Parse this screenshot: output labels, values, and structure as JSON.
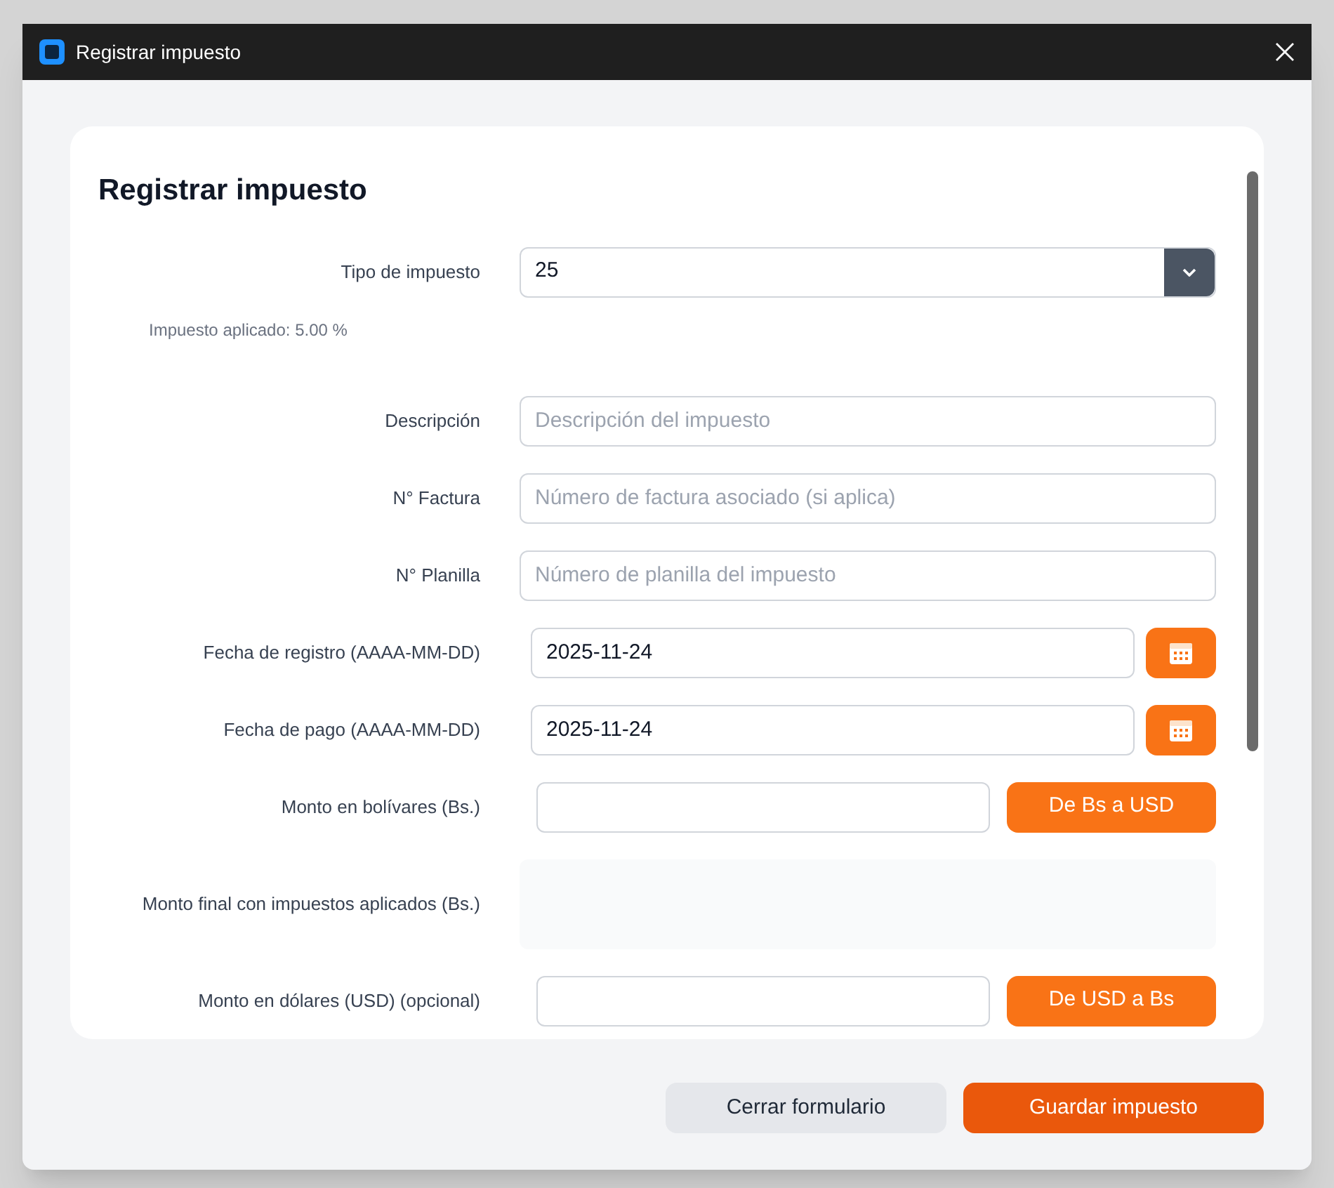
{
  "window": {
    "title": "Registrar impuesto"
  },
  "form": {
    "heading": "Registrar impuesto",
    "fields": [
      {
        "kind": "select",
        "label": "Tipo de impuesto",
        "value": "25"
      },
      {
        "kind": "note",
        "text": "Impuesto aplicado: 5.00 %"
      },
      {
        "kind": "text",
        "label": "Descripción",
        "placeholder": "Descripción del impuesto"
      },
      {
        "kind": "text",
        "label": "N° Factura",
        "placeholder": "Número de factura asociado (si aplica)"
      },
      {
        "kind": "text",
        "label": "N° Planilla",
        "placeholder": "Número de planilla del impuesto"
      },
      {
        "kind": "date",
        "label": "Fecha de registro (AAAA-MM-DD)",
        "value": "2025-11-24"
      },
      {
        "kind": "date",
        "label": "Fecha de pago (AAAA-MM-DD)",
        "value": "2025-11-24"
      },
      {
        "kind": "amount",
        "label": "Monto en bolívares (Bs.)",
        "button": "De Bs a USD"
      },
      {
        "kind": "readonly",
        "label": "Monto final con impuestos aplicados (Bs.)"
      },
      {
        "kind": "amount",
        "label": "Monto en dólares (USD) (opcional)",
        "button": "De USD a Bs"
      }
    ]
  },
  "buttons": [
    {
      "kind": "secondary",
      "label": "Cerrar formulario"
    },
    {
      "kind": "primary",
      "label": "Guardar impuesto"
    }
  ]
}
